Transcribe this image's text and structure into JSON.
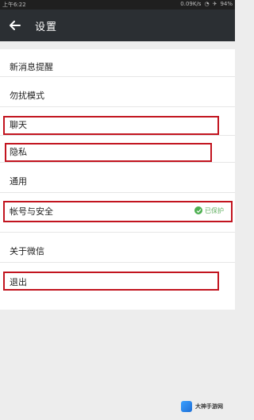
{
  "status_bar": {
    "left_text": "上午6:22",
    "speed": "0.09K/s",
    "battery": "94%"
  },
  "header": {
    "title": "设置",
    "back_icon": "arrow-left-icon"
  },
  "settings": {
    "items": [
      {
        "label": "新消息提醒"
      },
      {
        "label": "勿扰模式"
      },
      {
        "label": "聊天"
      },
      {
        "label": "隐私"
      },
      {
        "label": "通用"
      },
      {
        "label": "帐号与安全"
      },
      {
        "label": "关于微信"
      },
      {
        "label": "退出"
      }
    ],
    "account_security_badge": "已保护"
  },
  "watermark": {
    "line1": "大神手游网",
    "line2": ""
  },
  "colors": {
    "highlight": "#c2141f",
    "appbar": "#2b2f33",
    "background": "#ededed"
  }
}
